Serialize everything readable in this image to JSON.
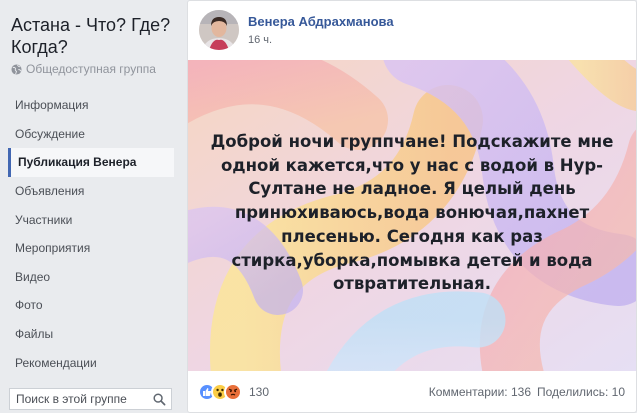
{
  "group": {
    "title": "Астана - Что? Где? Когда?",
    "type": "Общедоступная группа"
  },
  "nav": {
    "items": [
      {
        "label": "Информация",
        "active": false
      },
      {
        "label": "Обсуждение",
        "active": false
      },
      {
        "label": "Публикация Венера",
        "active": true
      },
      {
        "label": "Объявления",
        "active": false
      },
      {
        "label": "Участники",
        "active": false
      },
      {
        "label": "Мероприятия",
        "active": false
      },
      {
        "label": "Видео",
        "active": false
      },
      {
        "label": "Фото",
        "active": false
      },
      {
        "label": "Файлы",
        "active": false
      },
      {
        "label": "Рекомендации",
        "active": false
      }
    ]
  },
  "search": {
    "placeholder": "Поиск в этой группе"
  },
  "post": {
    "author": "Венера Абдрахманова",
    "time": "16 ч.",
    "text": "Доброй ночи группчане! Подскажите мне одной кажется,что у нас с водой в Нур-Султане не ладное. Я целый день принюхиваюсь,вода вонючая,пахнет плесенью. Сегодня как раз стирка,уборка,помывка детей и вода отвратительная.",
    "reactions": [
      "like-icon",
      "wow-icon",
      "angry-icon"
    ],
    "reaction_count": "130",
    "comments": "Комментарии: 136",
    "shares": "Поделились: 10"
  },
  "colors": {
    "link": "#365899",
    "accent": "#4267b2"
  }
}
